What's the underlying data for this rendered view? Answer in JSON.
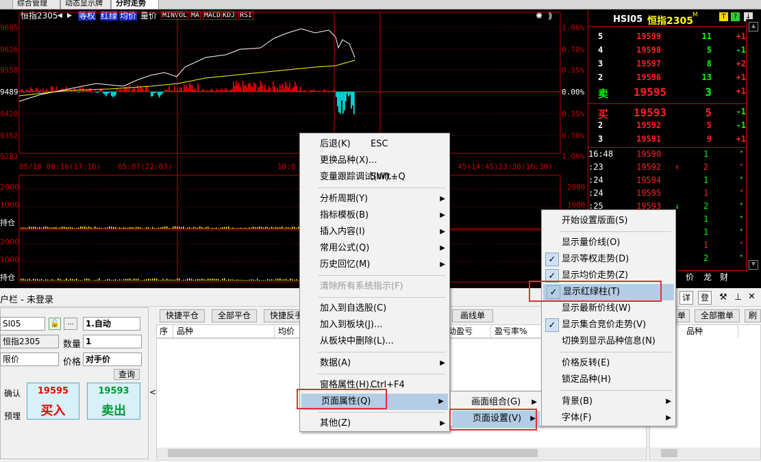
{
  "top_tabs": [
    "综合管理",
    "动态显示牌",
    "分时走势"
  ],
  "chart": {
    "symbol": "恒指2305",
    "nav_prev": "◀",
    "nav_next": "▶",
    "buttons": [
      "等权",
      "红绿",
      "均价",
      "量价"
    ],
    "indicators": [
      "MINVOL",
      "MA",
      "MACD",
      "KDJ",
      "RSI"
    ],
    "right_buttons": "⟫",
    "price_left": [
      "9695",
      "9626",
      "9558",
      "9489",
      "9420",
      "9352",
      "9283"
    ],
    "pct_right": [
      "1.06%",
      "0.70%",
      "0.35%",
      "0.00%",
      "0.35%",
      "0.70%",
      "1.06%"
    ],
    "time_labels": [
      "05/18  00:16(17:16)",
      "05:07(22:07)",
      "10:0",
      "45(14:45)23:30(16:30)"
    ],
    "vol_left": [
      "2000",
      "1000",
      "持仓"
    ],
    "vol_left2": [
      "2000",
      "1000",
      "持仓"
    ],
    "vol_right": [
      "2000",
      "1000"
    ],
    "colors": {
      "price": "#ffffff",
      "avg": "#ffff00",
      "up": "#ff0000",
      "down": "#00ffff",
      "grid": "#c00000"
    }
  },
  "quote": {
    "code": "HSI05",
    "name": "恒指2305",
    "sup": "M",
    "icons": [
      "T",
      "?",
      "↓"
    ],
    "asks": [
      {
        "lvl": "5",
        "price": "19599",
        "vol": "11",
        "chg": "+1"
      },
      {
        "lvl": "4",
        "price": "19598",
        "vol": "5",
        "chg": "-1"
      },
      {
        "lvl": "3",
        "price": "19597",
        "vol": "8",
        "chg": "+2"
      },
      {
        "lvl": "2",
        "price": "19596",
        "vol": "13",
        "chg": "+1"
      },
      {
        "lvl": "卖",
        "price": "19595",
        "vol": "3",
        "chg": "+1"
      }
    ],
    "bids": [
      {
        "lvl": "买",
        "price": "19593",
        "vol": "5",
        "chg": "-1"
      },
      {
        "lvl": "2",
        "price": "19592",
        "vol": "5",
        "chg": "-1"
      },
      {
        "lvl": "3",
        "price": "19591",
        "vol": "9",
        "chg": "+1"
      }
    ],
    "ticks": [
      {
        "time": "16:48",
        "price": "19590",
        "arrow": "",
        "vol": "1"
      },
      {
        "time": ":23",
        "price": "19592",
        "arrow": "↑",
        "vol": "2"
      },
      {
        "time": ":24",
        "price": "19594",
        "arrow": "",
        "vol": "1"
      },
      {
        "time": ":24",
        "price": "19595",
        "arrow": "",
        "vol": "1"
      },
      {
        "time": ":25",
        "price": "19593",
        "arrow": "↓",
        "vol": "2"
      },
      {
        "time": "",
        "price": "",
        "arrow": "",
        "vol": "1"
      },
      {
        "time": "",
        "price": "",
        "arrow": "",
        "vol": "1"
      },
      {
        "time": "",
        "price": "",
        "arrow": "",
        "vol": "1"
      },
      {
        "time": "",
        "price": "",
        "arrow": "",
        "vol": "2"
      }
    ],
    "bottom_tabs": [
      "价",
      "龙",
      "财"
    ]
  },
  "trade": {
    "title": "户栏 - 未登录",
    "account": "SI05",
    "mode": "1.自动",
    "symbol": "恒指2305",
    "qty_label": "数量",
    "qty": "1",
    "order_type": "限价",
    "price_label": "价格",
    "price": "对手价",
    "query": "查询",
    "confirm": "确认",
    "pre": "预埋",
    "buy_price": "19595",
    "buy_label": "买入",
    "sell_price": "19593",
    "sell_label": "卖出",
    "mid_buttons": [
      "快捷平仓",
      "全部平仓",
      "快捷反手"
    ],
    "mid_headers": [
      "序",
      "品种",
      "均价"
    ],
    "mid_headers2": [
      "动盈亏",
      "盈亏率%"
    ],
    "draw_btn": "画线单",
    "right_buttons": [
      "单",
      "全部撤单",
      "刷"
    ],
    "right_header": "品种",
    "top_icons": [
      "详",
      "登",
      "✕"
    ]
  },
  "menu1": {
    "items": [
      {
        "t": "后退(K)",
        "s": "ESC"
      },
      {
        "t": "更换品种(X)..."
      },
      {
        "t": "变量跟踪调试(W)...",
        "s": "Shift+Q"
      },
      {
        "t": "分析周期(Y)",
        "sub": true
      },
      {
        "t": "指标模板(B)",
        "sub": true
      },
      {
        "t": "插入内容(I)",
        "sub": true
      },
      {
        "t": "常用公式(Q)",
        "sub": true
      },
      {
        "t": "历史回忆(M)",
        "sub": true
      },
      {
        "t": "清除所有系统指示(F)",
        "dis": true
      },
      {
        "t": "加入到自选股(C)"
      },
      {
        "t": "加入到板块(J)..."
      },
      {
        "t": "从板块中删除(L)..."
      },
      {
        "t": "数据(A)",
        "sub": true
      },
      {
        "t": "窗格属性(H)...",
        "s": "Ctrl+F4"
      },
      {
        "t": "页面属性(Q)",
        "sub": true
      },
      {
        "t": "其他(Z)",
        "sub": true
      }
    ]
  },
  "menu2": {
    "items": [
      {
        "t": "画面组合(G)",
        "sub": true
      },
      {
        "t": "页面设置(V)",
        "sub": true
      }
    ]
  },
  "menu3": {
    "items": [
      {
        "t": "开始设置版面(S)"
      },
      {
        "t": "显示量价线(O)"
      },
      {
        "t": "显示等权走势(D)",
        "c": true
      },
      {
        "t": "显示均价走势(Z)",
        "c": true
      },
      {
        "t": "显示红绿柱(T)",
        "c": true
      },
      {
        "t": "显示最新价线(W)"
      },
      {
        "t": "显示集合竞价走势(V)",
        "c": true
      },
      {
        "t": "切换到显示品种信息(N)"
      },
      {
        "t": "价格反转(E)"
      },
      {
        "t": "锁定品种(H)"
      },
      {
        "t": "背景(B)",
        "sub": true
      },
      {
        "t": "字体(F)",
        "sub": true
      }
    ]
  }
}
